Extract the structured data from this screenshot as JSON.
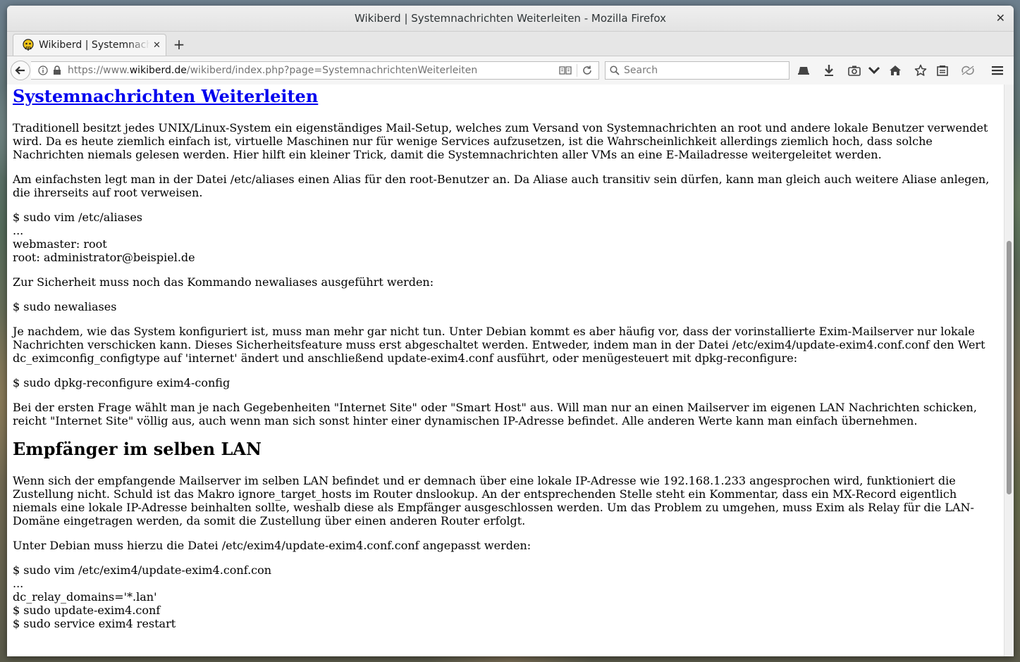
{
  "window": {
    "title": "Wikiberd | Systemnachrichten Weiterleiten - Mozilla Firefox",
    "close_glyph": "✕"
  },
  "tab": {
    "label": "Wikiberd | Systemnachrichten Weiterleiten",
    "close_glyph": "✕",
    "new_tab_glyph": "+"
  },
  "urlbar": {
    "prefix": "https://www.",
    "host": "wikiberd.de",
    "path": "/wikiberd/index.php?page=SystemnachrichtenWeiterleiten"
  },
  "search": {
    "placeholder": "Search"
  },
  "toolbar_icons": [
    "history-icon",
    "downloads-icon",
    "screenshot-icon",
    "pocket-icon",
    "home-icon",
    "bookmark-star-icon",
    "reading-list-icon",
    "sync-icon",
    "menu-icon"
  ],
  "article": {
    "title": "Systemnachrichten Weiterleiten",
    "p1": "Traditionell besitzt jedes UNIX/Linux-System ein eigenständiges Mail-Setup, welches zum Versand von Systemnachrichten an root und andere lokale Benutzer verwendet wird. Da es heute ziemlich einfach ist, virtuelle Maschinen nur für wenige Services aufzusetzen, ist die Wahrscheinlichkeit allerdings ziemlich hoch, dass solche Nachrichten niemals gelesen werden. Hier hilft ein kleiner Trick, damit die Systemnachrichten aller VMs an eine E-Mailadresse weitergeleitet werden.",
    "p2": "Am einfachsten legt man in der Datei /etc/aliases einen Alias für den root-Benutzer an. Da Aliase auch transitiv sein dürfen, kann man gleich auch weitere Aliase anlegen, die ihrerseits auf root verweisen.",
    "code1": [
      "$ sudo vim /etc/aliases",
      "...",
      "webmaster: root",
      "root: administrator@beispiel.de"
    ],
    "p3": "Zur Sicherheit muss noch das Kommando newaliases ausgeführt werden:",
    "code2": "$ sudo newaliases",
    "p4": "Je nachdem, wie das System konfiguriert ist, muss man mehr gar nicht tun. Unter Debian kommt es aber häufig vor, dass der vorinstallierte Exim-Mailserver nur lokale Nachrichten verschicken kann. Dieses Sicherheitsfeature muss erst abgeschaltet werden. Entweder, indem man in der Datei /etc/exim4/update-exim4.conf.conf den Wert dc_eximconfig_configtype auf 'internet' ändert und anschließend update-exim4.conf ausführt, oder menügesteuert mit dpkg-reconfigure:",
    "code3": "$ sudo dpkg-reconfigure exim4-config",
    "p5": "Bei der ersten Frage wählt man je nach Gegebenheiten \"Internet Site\" oder \"Smart Host\" aus. Will man nur an einen Mailserver im eigenen LAN Nachrichten schicken, reicht \"Internet Site\" völlig aus, auch wenn man sich sonst hinter einer dynamischen IP-Adresse befindet. Alle anderen Werte kann man einfach übernehmen.",
    "h2": "Empfänger im selben LAN",
    "p6": "Wenn sich der empfangende Mailserver im selben LAN befindet und er demnach über eine lokale IP-Adresse wie 192.168.1.233 angesprochen wird, funktioniert die Zustellung nicht. Schuld ist das Makro ignore_target_hosts im Router dnslookup. An der entsprechenden Stelle steht ein Kommentar, dass ein MX-Record eigentlich niemals eine lokale IP-Adresse beinhalten sollte, weshalb diese als Empfänger ausgeschlossen werden. Um das Problem zu umgehen, muss Exim als Relay für die LAN-Domäne eingetragen werden, da somit die Zustellung über einen anderen Router erfolgt.",
    "p7": "Unter Debian muss hierzu die Datei /etc/exim4/update-exim4.conf.conf angepasst werden:",
    "code4": [
      "$ sudo vim /etc/exim4/update-exim4.conf.con",
      "...",
      "dc_relay_domains='*.lan'",
      "$ sudo update-exim4.conf",
      "$ sudo service exim4 restart"
    ]
  }
}
